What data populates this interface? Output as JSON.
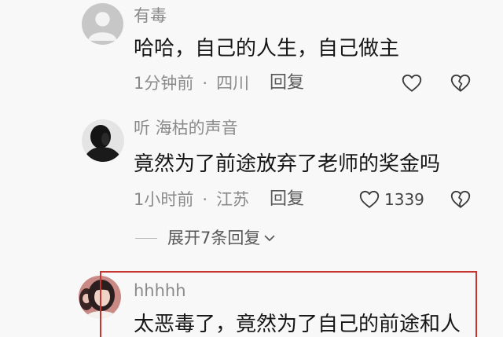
{
  "colors": {
    "background": "#f8f8f8",
    "text_primary": "#161616",
    "text_secondary": "#8a8a8a",
    "reply": "#585858",
    "icon": "#3a3a3a",
    "count": "#444444",
    "divider": "#bdbdbd",
    "highlight_box": "#c8342f"
  },
  "icons": {
    "like": "heart-outline-icon",
    "dislike": "broken-heart-icon",
    "expand": "chevron-down-icon"
  },
  "meta_separator": "·",
  "comments": [
    {
      "username": "有毒",
      "text": "哈哈，自己的人生，自己做主",
      "time": "1分钟前",
      "location": "四川",
      "reply_label": "回复"
    },
    {
      "username": "听 海枯的声音",
      "text": "竟然为了前途放弃了老师的奖金吗",
      "time": "1小时前",
      "location": "江苏",
      "reply_label": "回复",
      "like_count": "1339"
    },
    {
      "username": "hhhhh",
      "text": "太恶毒了，竟然为了自己的前途和人",
      "highlighted": true
    }
  ],
  "expand_replies": {
    "label": "展开7条回复"
  }
}
